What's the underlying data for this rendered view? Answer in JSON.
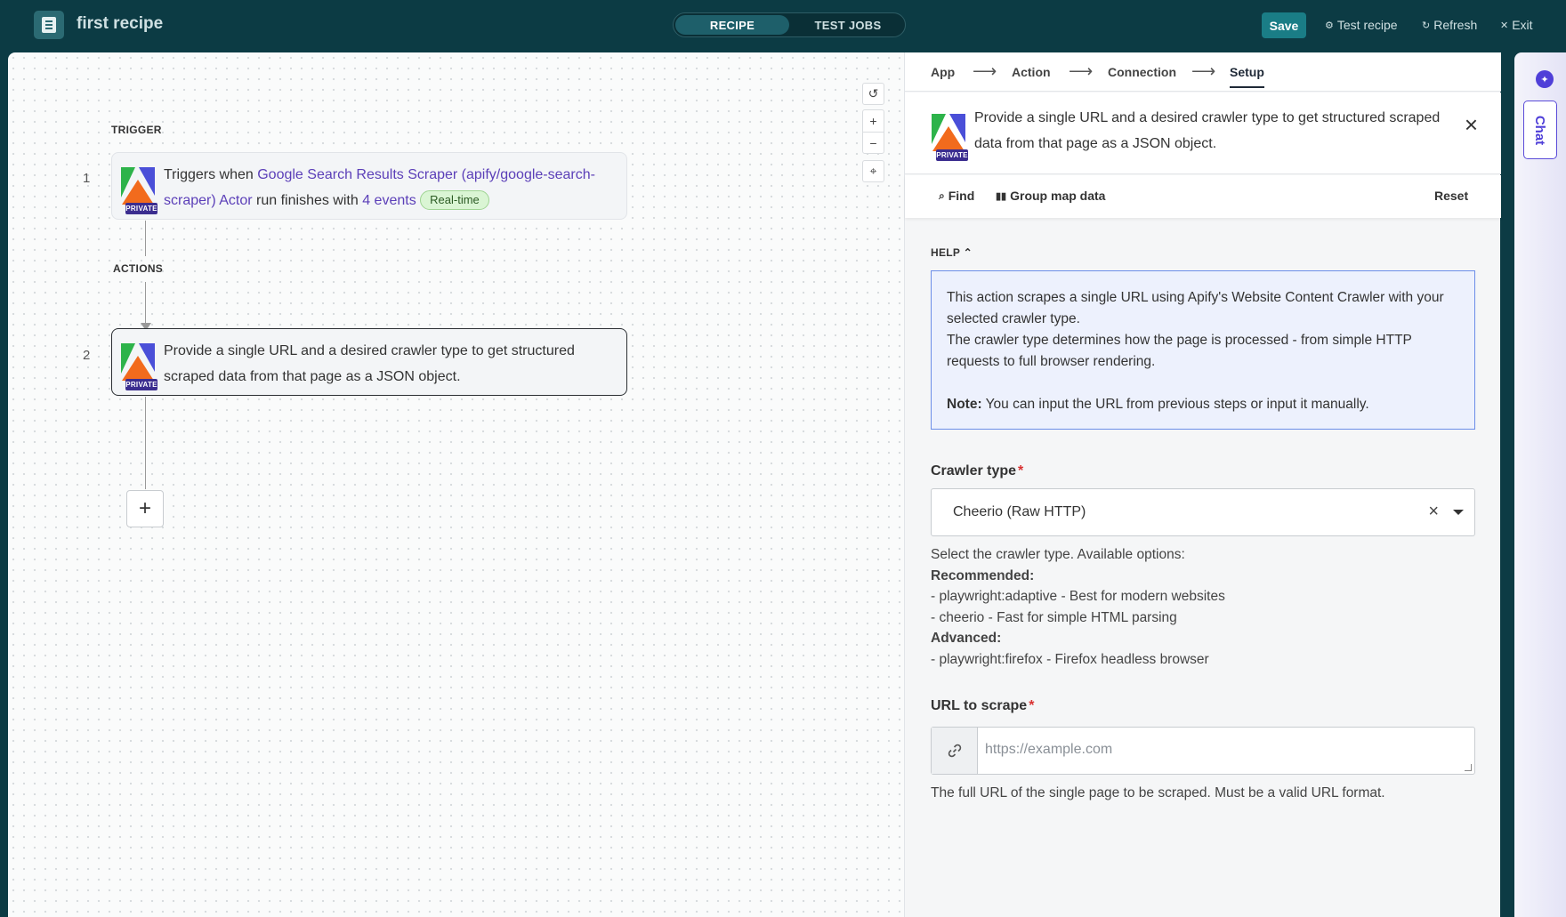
{
  "header": {
    "recipe_name": "first recipe",
    "tabs": [
      "RECIPE",
      "TEST JOBS"
    ],
    "save": "Save",
    "test_recipe": "Test recipe",
    "refresh": "Refresh",
    "exit": "Exit"
  },
  "canvas": {
    "trigger_label": "TRIGGER",
    "actions_label": "ACTIONS",
    "badge": "PRIVATE",
    "step1": {
      "num": "1",
      "prefix": "Triggers when ",
      "link1": "Google Search Results Scraper (apify/google-search-scraper) Actor",
      "middle": " run finishes with ",
      "link2": "4 events",
      "pill": "Real-time"
    },
    "step2": {
      "num": "2",
      "text": "Provide a single URL and a desired crawler type to get structured scraped data from that page as a JSON object."
    },
    "controls": [
      "reset-icon",
      "zoom-in-icon",
      "zoom-out-icon",
      "fit-view-icon"
    ]
  },
  "panel": {
    "breadcrumb": [
      "App",
      "Action",
      "Connection",
      "Setup"
    ],
    "header_text": "Provide a single URL and a desired crawler type to get structured scraped data from that page as a JSON object.",
    "find": "Find",
    "group_map": "Group map data",
    "reset": "Reset",
    "help_label": "HELP",
    "help_line1": "This action scrapes a single URL using Apify's Website Content Crawler with your selected crawler type.",
    "help_line2": "The crawler type determines how the page is processed - from simple HTTP requests to full browser rendering.",
    "help_note_label": "Note:",
    "help_note": " You can input the URL from previous steps or input it manually.",
    "crawler_label": "Crawler type",
    "crawler_value": "Cheerio (Raw HTTP)",
    "crawler_hint": {
      "intro": "Select the crawler type. Available options:",
      "recommended": "Recommended:",
      "opt1": "- playwright:adaptive - Best for modern websites",
      "opt2": "- cheerio - Fast for simple HTML parsing",
      "advanced": "Advanced:",
      "opt3": "- playwright:firefox - Firefox headless browser"
    },
    "url_label": "URL to scrape",
    "url_placeholder": "https://example.com",
    "url_value": "",
    "url_hint": "The full URL of the single page to be scraped. Must be a valid URL format.",
    "required_mark": "*"
  },
  "chat": {
    "label": "Chat"
  },
  "colors": {
    "topbar": "#0c3b44",
    "accent": "#1a7d86",
    "link": "#5b3fb8",
    "help_border": "#6c8de8",
    "required": "#d93232"
  }
}
